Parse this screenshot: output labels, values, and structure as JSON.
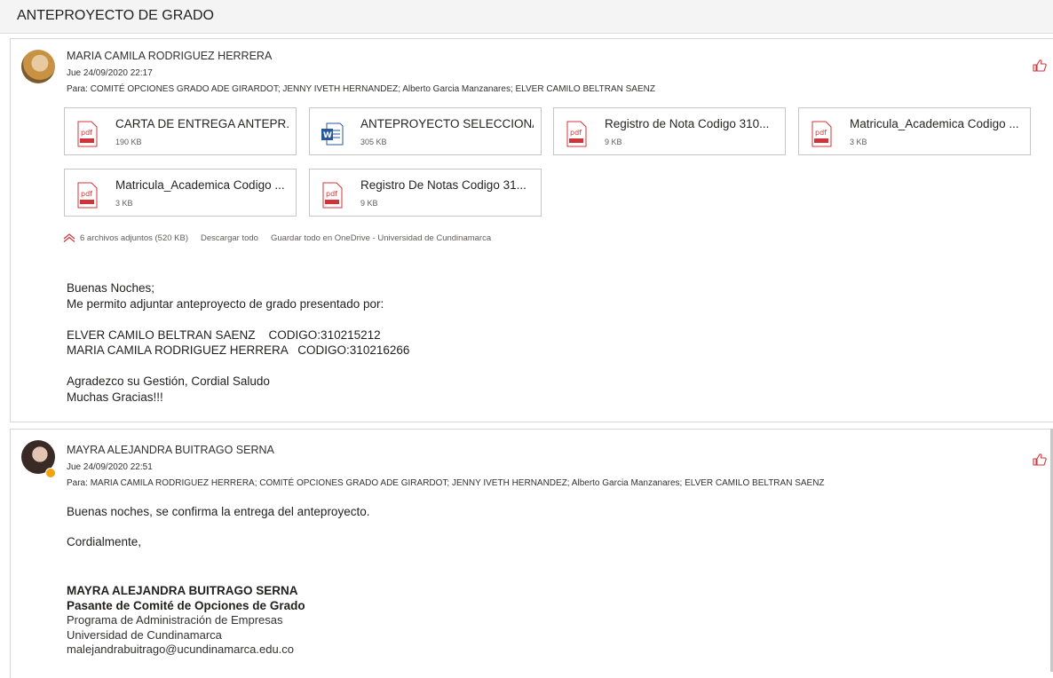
{
  "subject": "ANTEPROYECTO DE GRADO",
  "messages": [
    {
      "sender": "MARIA CAMILA RODRIGUEZ HERRERA",
      "date": "Jue 24/09/2020 22:17",
      "to_label": "Para:",
      "to": "COMITÉ OPCIONES GRADO ADE GIRARDOT; JENNY IVETH HERNANDEZ; Alberto Garcia Manzanares; ELVER CAMILO BELTRAN SAENZ",
      "attachments": [
        {
          "name": "CARTA DE ENTREGA ANTEPR...",
          "size": "190 KB",
          "type": "pdf"
        },
        {
          "name": "ANTEPROYECTO SELECCIONA...",
          "size": "305 KB",
          "type": "word"
        },
        {
          "name": "Registro de Nota Codigo 310...",
          "size": "9 KB",
          "type": "pdf"
        },
        {
          "name": "Matricula_Academica Codigo ...",
          "size": "3 KB",
          "type": "pdf"
        },
        {
          "name": "Matricula_Academica Codigo ...",
          "size": "3 KB",
          "type": "pdf"
        },
        {
          "name": "Registro De Notas Codigo 31...",
          "size": "9 KB",
          "type": "pdf"
        }
      ],
      "attach_summary": "6 archivos adjuntos (520 KB)",
      "download_all": "Descargar todo",
      "save_onedrive": "Guardar todo en OneDrive - Universidad de Cundinamarca",
      "body": [
        "Buenas Noches;",
        "Me permito adjuntar anteproyecto de grado presentado por:",
        "",
        "ELVER CAMILO BELTRAN SAENZ    CODIGO:310215212",
        "MARIA CAMILA RODRIGUEZ HERRERA   CODIGO:310216266",
        "",
        "Agradezco su Gestión, Cordial Saludo",
        "Muchas Gracias!!!"
      ]
    },
    {
      "sender": "MAYRA ALEJANDRA BUITRAGO SERNA",
      "date": "Jue 24/09/2020 22:51",
      "to_label": "Para:",
      "to": "MARIA CAMILA RODRIGUEZ HERRERA; COMITÉ OPCIONES GRADO ADE GIRARDOT; JENNY IVETH HERNANDEZ; Alberto Garcia Manzanares; ELVER CAMILO BELTRAN SAENZ",
      "body1": "Buenas noches, se confirma la entrega del anteproyecto.",
      "body2": "Cordialmente,",
      "signature": {
        "name": "MAYRA ALEJANDRA BUITRAGO SERNA",
        "role": "Pasante de Comité de Opciones de Grado",
        "program": "Programa de Administración de Empresas",
        "university": "Universidad de Cundinamarca",
        "email": "malejandrabuitrago@ucundinamarca.edu.co"
      }
    }
  ],
  "colors": {
    "accent_red": "#d13438",
    "word_blue": "#2b579a"
  }
}
